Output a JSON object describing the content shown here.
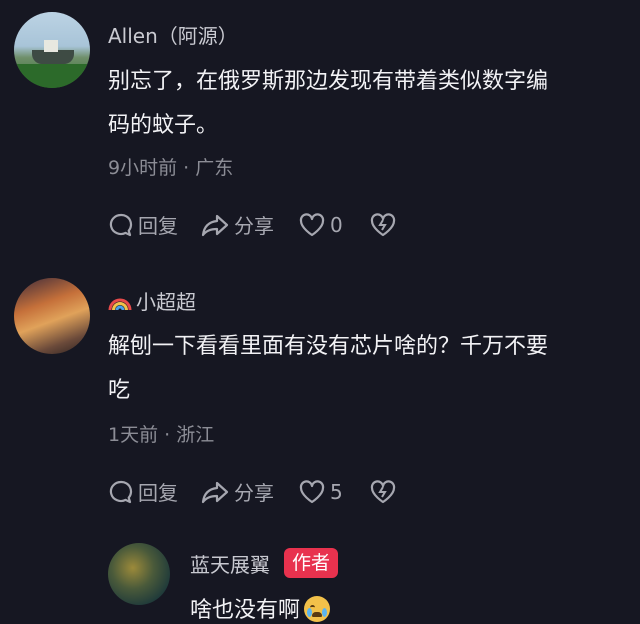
{
  "comments": [
    {
      "username": "Allen（阿源）",
      "text_line1": "别忘了，在俄罗斯那边发现有带着类似数字编",
      "text_line2": "码的蚊子。",
      "meta": "9小时前 · 广东",
      "reply_label": "回复",
      "share_label": "分享",
      "like_count": "0"
    },
    {
      "username": "小超超",
      "text_line1": "解刨一下看看里面有没有芯片啥的？千万不要",
      "text_line2": "吃",
      "meta": "1天前 · 浙江",
      "reply_label": "回复",
      "share_label": "分享",
      "like_count": "5"
    }
  ],
  "reply": {
    "username": "蓝天展翼",
    "badge": "作者",
    "text": "啥也没有啊"
  },
  "colors": {
    "background": "#161722",
    "author_badge": "#e8324e"
  },
  "icons": [
    "comment-bubble-icon",
    "share-arrow-icon",
    "heart-icon",
    "broken-heart-icon",
    "rainbow-icon",
    "crying-emoji-icon"
  ]
}
